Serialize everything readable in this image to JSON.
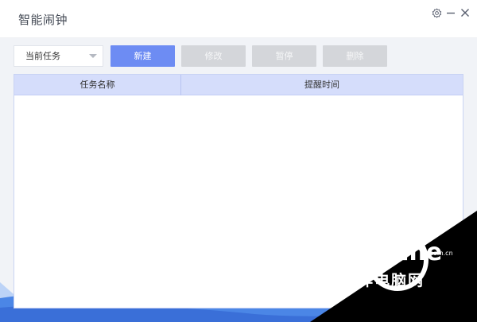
{
  "app": {
    "title": "智能闹钟"
  },
  "window_controls": {
    "settings_icon": "gear-icon",
    "minimize_icon": "minimize-icon",
    "close_icon": "close-icon"
  },
  "toolbar": {
    "filter_select": {
      "selected": "当前任务"
    },
    "buttons": {
      "new": "新建",
      "edit": "修改",
      "pause": "暂停",
      "delete": "删除"
    }
  },
  "table": {
    "columns": [
      "任务名称",
      "提醒时间"
    ],
    "rows": []
  },
  "watermark": {
    "brand": "PConline",
    "domain": ".com.cn",
    "tagline": "太平洋电脑网"
  },
  "colors": {
    "primary": "#6d8cf3",
    "disabled": "#d4d6da",
    "table_header": "#d5ddfb",
    "background": "#f1f3f7"
  }
}
